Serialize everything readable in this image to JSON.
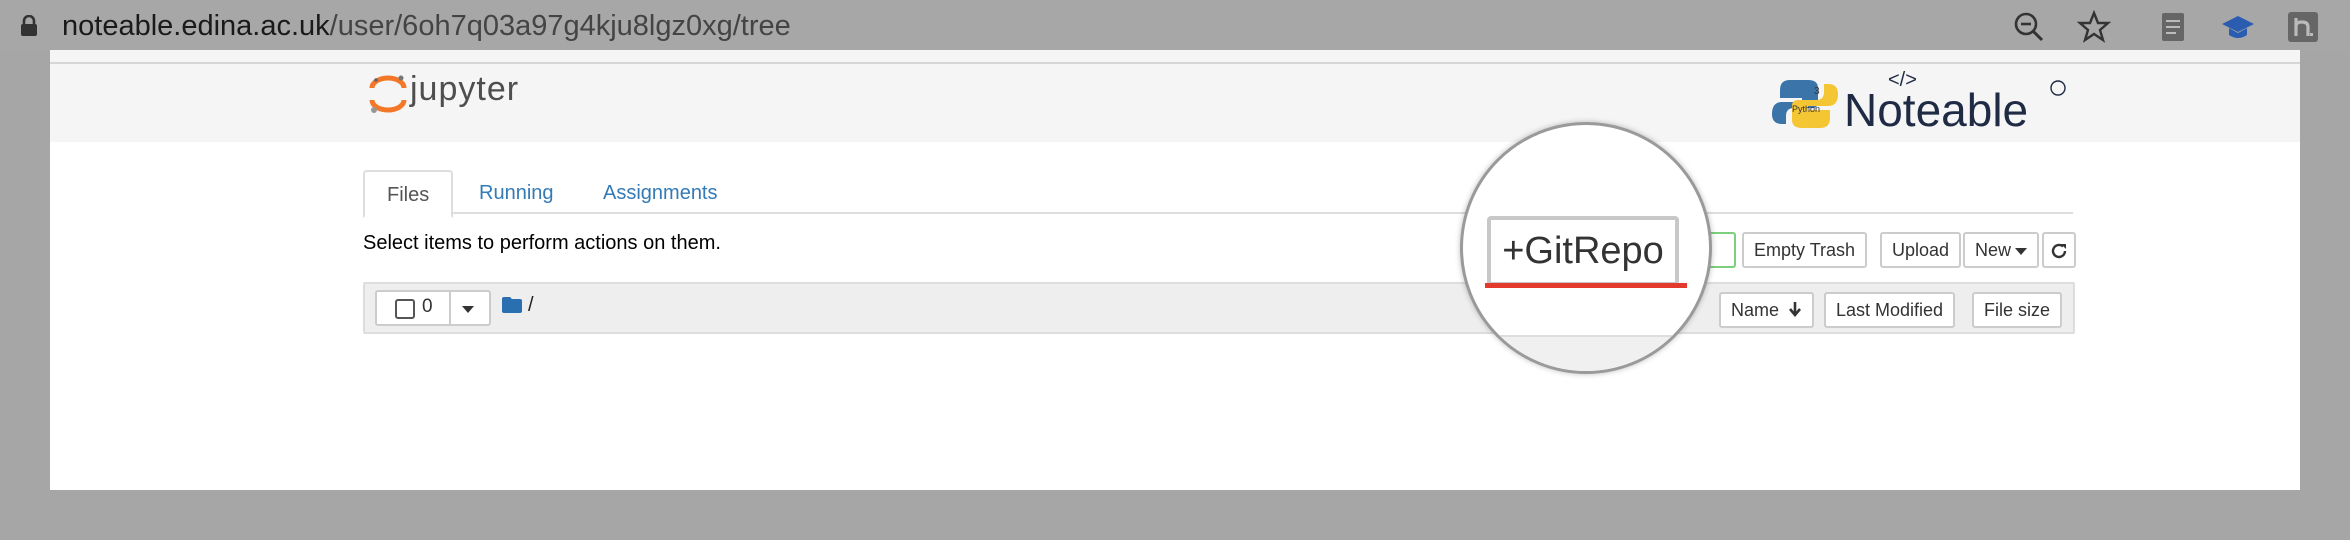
{
  "browser": {
    "url_domain": "noteable.edina.ac.uk",
    "url_path": "/user/6oh7q03a97g4kju8lgz0xg/tree",
    "icons": [
      "lock-icon",
      "zoom-out-icon",
      "star-icon",
      "document-icon",
      "graduation-cap-icon",
      "h-extension-icon"
    ]
  },
  "header": {
    "logo_text": "jupyter",
    "brand_logo_text": "Noteable",
    "python_badge": "Python",
    "python_version": "3",
    "code_tag": "</>"
  },
  "tabs": [
    {
      "label": "Files",
      "active": true
    },
    {
      "label": "Running",
      "active": false
    },
    {
      "label": "Assignments",
      "active": false
    }
  ],
  "hint": "Select items to perform actions on them.",
  "actions": {
    "gitrepo": "+GitRepo",
    "empty_trash": "Empty Trash",
    "upload": "Upload",
    "new": "New"
  },
  "list": {
    "selected_count": "0",
    "path": "/",
    "sort_name": "Name",
    "last_modified": "Last Modified",
    "file_size": "File size"
  },
  "colors": {
    "accent_link": "#337ab7",
    "highlight_red": "#e23b2e",
    "jupyter_orange": "#f37726"
  }
}
